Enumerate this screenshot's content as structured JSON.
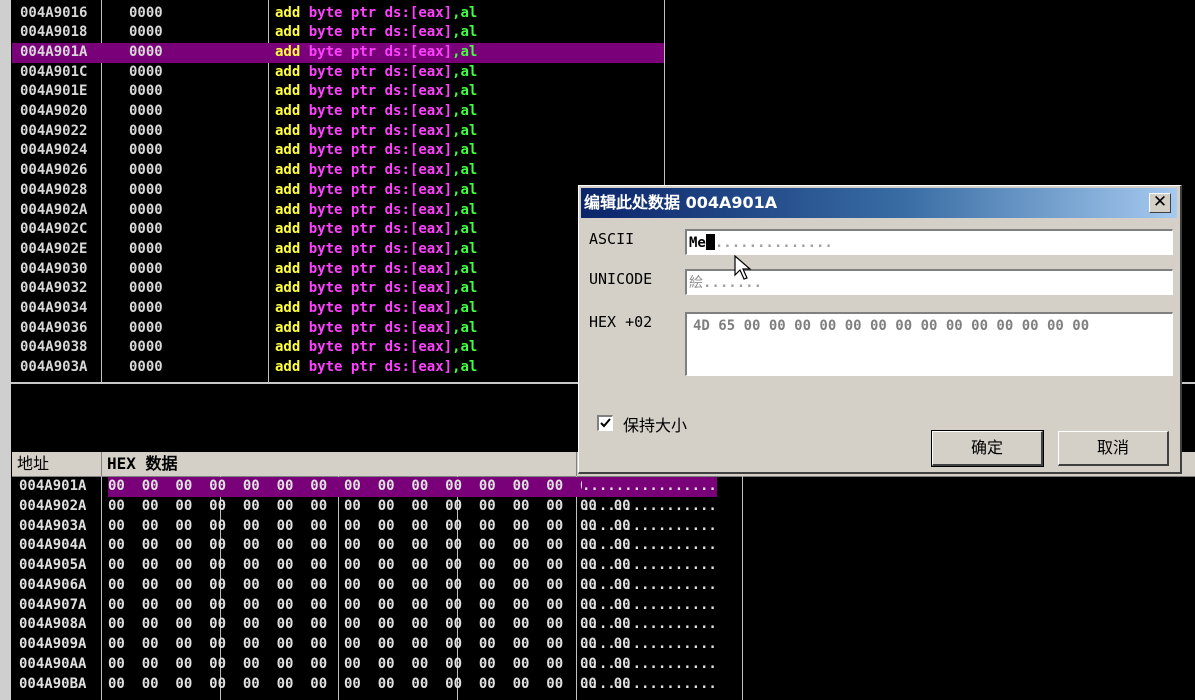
{
  "disasm": {
    "rows": [
      {
        "addr": "004A9016",
        "code": "0000",
        "asm": [
          "add",
          "byte",
          "ptr",
          "ds:[eax]",
          ",al"
        ],
        "selected": false
      },
      {
        "addr": "004A9018",
        "code": "0000",
        "asm": [
          "add",
          "byte",
          "ptr",
          "ds:[eax]",
          ",al"
        ],
        "selected": false
      },
      {
        "addr": "004A901A",
        "code": "0000",
        "asm": [
          "add",
          "byte",
          "ptr",
          "ds:[eax]",
          ",al"
        ],
        "selected": true
      },
      {
        "addr": "004A901C",
        "code": "0000",
        "asm": [
          "add",
          "byte",
          "ptr",
          "ds:[eax]",
          ",al"
        ],
        "selected": false
      },
      {
        "addr": "004A901E",
        "code": "0000",
        "asm": [
          "add",
          "byte",
          "ptr",
          "ds:[eax]",
          ",al"
        ],
        "selected": false
      },
      {
        "addr": "004A9020",
        "code": "0000",
        "asm": [
          "add",
          "byte",
          "ptr",
          "ds:[eax]",
          ",al"
        ],
        "selected": false
      },
      {
        "addr": "004A9022",
        "code": "0000",
        "asm": [
          "add",
          "byte",
          "ptr",
          "ds:[eax]",
          ",al"
        ],
        "selected": false
      },
      {
        "addr": "004A9024",
        "code": "0000",
        "asm": [
          "add",
          "byte",
          "ptr",
          "ds:[eax]",
          ",al"
        ],
        "selected": false
      },
      {
        "addr": "004A9026",
        "code": "0000",
        "asm": [
          "add",
          "byte",
          "ptr",
          "ds:[eax]",
          ",al"
        ],
        "selected": false
      },
      {
        "addr": "004A9028",
        "code": "0000",
        "asm": [
          "add",
          "byte",
          "ptr",
          "ds:[eax]",
          ",al"
        ],
        "selected": false
      },
      {
        "addr": "004A902A",
        "code": "0000",
        "asm": [
          "add",
          "byte",
          "ptr",
          "ds:[eax]",
          ",al"
        ],
        "selected": false
      },
      {
        "addr": "004A902C",
        "code": "0000",
        "asm": [
          "add",
          "byte",
          "ptr",
          "ds:[eax]",
          ",al"
        ],
        "selected": false
      },
      {
        "addr": "004A902E",
        "code": "0000",
        "asm": [
          "add",
          "byte",
          "ptr",
          "ds:[eax]",
          ",al"
        ],
        "selected": false
      },
      {
        "addr": "004A9030",
        "code": "0000",
        "asm": [
          "add",
          "byte",
          "ptr",
          "ds:[eax]",
          ",al"
        ],
        "selected": false
      },
      {
        "addr": "004A9032",
        "code": "0000",
        "asm": [
          "add",
          "byte",
          "ptr",
          "ds:[eax]",
          ",al"
        ],
        "selected": false
      },
      {
        "addr": "004A9034",
        "code": "0000",
        "asm": [
          "add",
          "byte",
          "ptr",
          "ds:[eax]",
          ",al"
        ],
        "selected": false
      },
      {
        "addr": "004A9036",
        "code": "0000",
        "asm": [
          "add",
          "byte",
          "ptr",
          "ds:[eax]",
          ",al"
        ],
        "selected": false
      },
      {
        "addr": "004A9038",
        "code": "0000",
        "asm": [
          "add",
          "byte",
          "ptr",
          "ds:[eax]",
          ",al"
        ],
        "selected": false
      },
      {
        "addr": "004A903A",
        "code": "0000",
        "asm": [
          "add",
          "byte",
          "ptr",
          "ds:[eax]",
          ",al"
        ],
        "selected": false
      }
    ]
  },
  "dump": {
    "header": {
      "address": "地址",
      "hex_label": "HEX 数据"
    },
    "rows": [
      {
        "addr": "004A901A",
        "hex": "00 00 00 00 00 00 00 00 00 00 00 00 00 00 00 00",
        "ascii": "................",
        "selected": true
      },
      {
        "addr": "004A902A",
        "hex": "00 00 00 00 00 00 00 00 00 00 00 00 00 00 00 00",
        "ascii": "................",
        "selected": false
      },
      {
        "addr": "004A903A",
        "hex": "00 00 00 00 00 00 00 00 00 00 00 00 00 00 00 00",
        "ascii": "................",
        "selected": false
      },
      {
        "addr": "004A904A",
        "hex": "00 00 00 00 00 00 00 00 00 00 00 00 00 00 00 00",
        "ascii": "................",
        "selected": false
      },
      {
        "addr": "004A905A",
        "hex": "00 00 00 00 00 00 00 00 00 00 00 00 00 00 00 00",
        "ascii": "................",
        "selected": false
      },
      {
        "addr": "004A906A",
        "hex": "00 00 00 00 00 00 00 00 00 00 00 00 00 00 00 00",
        "ascii": "................",
        "selected": false
      },
      {
        "addr": "004A907A",
        "hex": "00 00 00 00 00 00 00 00 00 00 00 00 00 00 00 00",
        "ascii": "................",
        "selected": false
      },
      {
        "addr": "004A908A",
        "hex": "00 00 00 00 00 00 00 00 00 00 00 00 00 00 00 00",
        "ascii": "................",
        "selected": false
      },
      {
        "addr": "004A909A",
        "hex": "00 00 00 00 00 00 00 00 00 00 00 00 00 00 00 00",
        "ascii": "................",
        "selected": false
      },
      {
        "addr": "004A90AA",
        "hex": "00 00 00 00 00 00 00 00 00 00 00 00 00 00 00 00",
        "ascii": "................",
        "selected": false
      },
      {
        "addr": "004A90BA",
        "hex": "00 00 00 00 00 00 00 00 00 00 00 00 00 00 00 00",
        "ascii": "................",
        "selected": false
      }
    ]
  },
  "dialog": {
    "title": "编辑此处数据 004A901A",
    "close_symbol": "✕",
    "ascii_label": "ASCII",
    "ascii_value": "Me",
    "ascii_fill": "..............",
    "unicode_label": "UNICODE",
    "unicode_value": "絵",
    "unicode_fill": ".......",
    "hex_label": "HEX +02",
    "hex_value": "4D 65 00 00 00 00 00 00 00 00 00 00 00 00 00 00",
    "keep_size_label": "保持大小",
    "keep_size_checked": true,
    "ok_label": "确定",
    "cancel_label": "取消"
  },
  "icons": {
    "pointer": "mouse-pointer-icon",
    "checkmark": "checkmark-icon",
    "close": "close-icon"
  },
  "colors": {
    "selection": "#7a007a",
    "keyword": "#ffff40",
    "operand": "#ff40ff",
    "register": "#40ff40"
  }
}
